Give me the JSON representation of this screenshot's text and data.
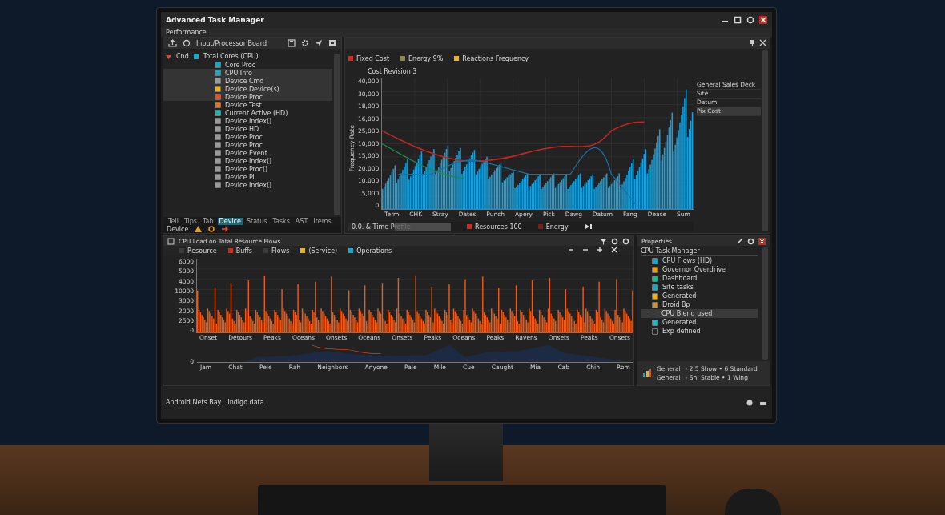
{
  "window": {
    "title": "Advanced Task Manager",
    "menu": "Performance"
  },
  "device_panel": {
    "toolbar_label": "Input/Processor Board",
    "tree": {
      "label": "Cnd",
      "badge": "Total Cores (CPU)",
      "expanded": true,
      "children": [
        {
          "label": "Core Proc",
          "color": "#1aa8c8",
          "selected": false
        },
        {
          "label": "CPU Info",
          "color": "#1aa8c8",
          "selected": true
        },
        {
          "label": "Device Cmd",
          "color": "#9a9a9a",
          "selected": true
        },
        {
          "label": "Device Device(s)",
          "color": "#e8b418",
          "selected": true
        },
        {
          "label": "Device Proc",
          "color": "#e0502a",
          "selected": true
        },
        {
          "label": "Device Test",
          "color": "#e0702a",
          "selected": false
        },
        {
          "label": "Current Active (HD)",
          "color": "#1ab8b0",
          "selected": false
        },
        {
          "label": "Device Index()",
          "color": "#9a9a9a",
          "selected": false
        },
        {
          "label": "Device HD",
          "color": "#9a9a9a",
          "selected": false
        },
        {
          "label": "Device Proc",
          "color": "#9a9a9a",
          "selected": false
        },
        {
          "label": "Device Proc",
          "color": "#9a9a9a",
          "selected": false
        },
        {
          "label": "Device Event",
          "color": "#9a9a9a",
          "selected": false
        },
        {
          "label": "Device Index()",
          "color": "#9a9a9a",
          "selected": false
        },
        {
          "label": "Device Proc()",
          "color": "#9a9a9a",
          "selected": false
        },
        {
          "label": "Device Pi",
          "color": "#9a9a9a",
          "selected": false
        },
        {
          "label": "Device Index()",
          "color": "#9a9a9a",
          "selected": false
        }
      ]
    },
    "tabs": [
      {
        "label": "Tell",
        "selected": false
      },
      {
        "label": "Tips",
        "selected": false
      },
      {
        "label": "Tab",
        "selected": false
      },
      {
        "label": "Device",
        "selected": true
      },
      {
        "label": "Status",
        "selected": false
      },
      {
        "label": "Tasks",
        "selected": false
      },
      {
        "label": "AST",
        "selected": false
      },
      {
        "label": "Items",
        "selected": false
      }
    ],
    "status": "Device"
  },
  "chart_panel": {
    "legend": [
      {
        "label": "Fixed Cost",
        "color": "#d42a1e"
      },
      {
        "label": "Energy 9%",
        "color": "#8a8a4a"
      },
      {
        "label": "Reactions Frequency",
        "color": "#e8b418"
      }
    ],
    "chart_title": "Cost Revision 3",
    "y_label": "Frequency Rate",
    "y_ticks": [
      "40,000",
      "30,000",
      "18,000",
      "16,000",
      "25,000",
      "10,000",
      "15,000",
      "20,000",
      "10,000",
      "5,000",
      "0"
    ],
    "x_ticks": [
      "Term",
      "CHK",
      "Stray",
      "Dates",
      "Punch",
      "Apery",
      "Pick",
      "Dawg",
      "Datum",
      "Fang",
      "Dease",
      "Sum"
    ],
    "series_list": [
      {
        "label": "General Sales Deck",
        "selected": false
      },
      {
        "label": "Site",
        "selected": false
      },
      {
        "label": "Datum",
        "selected": false
      },
      {
        "label": "Pix Cost",
        "selected": true
      }
    ],
    "footer": {
      "range": "0.0. & Time Profile",
      "level": 0.55,
      "resources": "Resources 100",
      "energy": "Energy"
    }
  },
  "load_panel": {
    "title": "CPU Load on Total Resource Flows",
    "legend": [
      {
        "label": "Resource",
        "color": "#3a3a3a"
      },
      {
        "label": "Buffs",
        "color": "#d42a1e"
      },
      {
        "label": "Flows",
        "color": "#3a3a3a"
      },
      {
        "label": "(Service)",
        "color": "#e8b418"
      },
      {
        "label": "Operations",
        "color": "#1aa8c8"
      }
    ],
    "y_ticks": [
      "6000",
      "5000",
      "4000",
      "10000",
      "3000",
      "2000",
      "2500",
      "0"
    ],
    "x_ticks": [
      "Onset",
      "Detours",
      "Peaks",
      "Oceans",
      "Onsets",
      "Oceans",
      "Onsets",
      "Peaks",
      "Oceans",
      "Peaks",
      "Ravens",
      "Onsets",
      "Peaks",
      "Onsets"
    ],
    "mini_zero": "0",
    "mini_x_ticks": [
      "Jam",
      "Chat",
      "Pele",
      "Rah",
      "Neighbors",
      "Anyone",
      "Pale",
      "Mile",
      "Cue",
      "Caught",
      "Mia",
      "Cab",
      "Chin",
      "Rom"
    ]
  },
  "properties_panel": {
    "title": "Properties",
    "tree_title": "CPU Task Manager",
    "items": [
      {
        "label": "CPU Flows (HD)",
        "color": "#1aa8c8"
      },
      {
        "label": "Governor Overdrive",
        "color": "#e8a018"
      },
      {
        "label": "Dashboard",
        "color": "#1ab890"
      },
      {
        "label": "Site tasks",
        "color": "#1aa8c8"
      },
      {
        "label": "Generated",
        "color": "#e8b418"
      },
      {
        "label": "Droid Bp",
        "color": "#c89040",
        "children": [
          {
            "label": "CPU Blend used",
            "selected": true
          }
        ]
      },
      {
        "label": "Generated",
        "color": "#1ab8c8"
      },
      {
        "label": "Exp defined",
        "color": "#252525"
      }
    ],
    "info": [
      {
        "name": "General",
        "value": "- 2.5 Show • 6 Standard"
      },
      {
        "name": "General",
        "value": "- Sh. Stable • 1 Wing"
      }
    ]
  },
  "status_bar": {
    "left": "Android Nets Bay",
    "right": "Indigo data"
  }
}
